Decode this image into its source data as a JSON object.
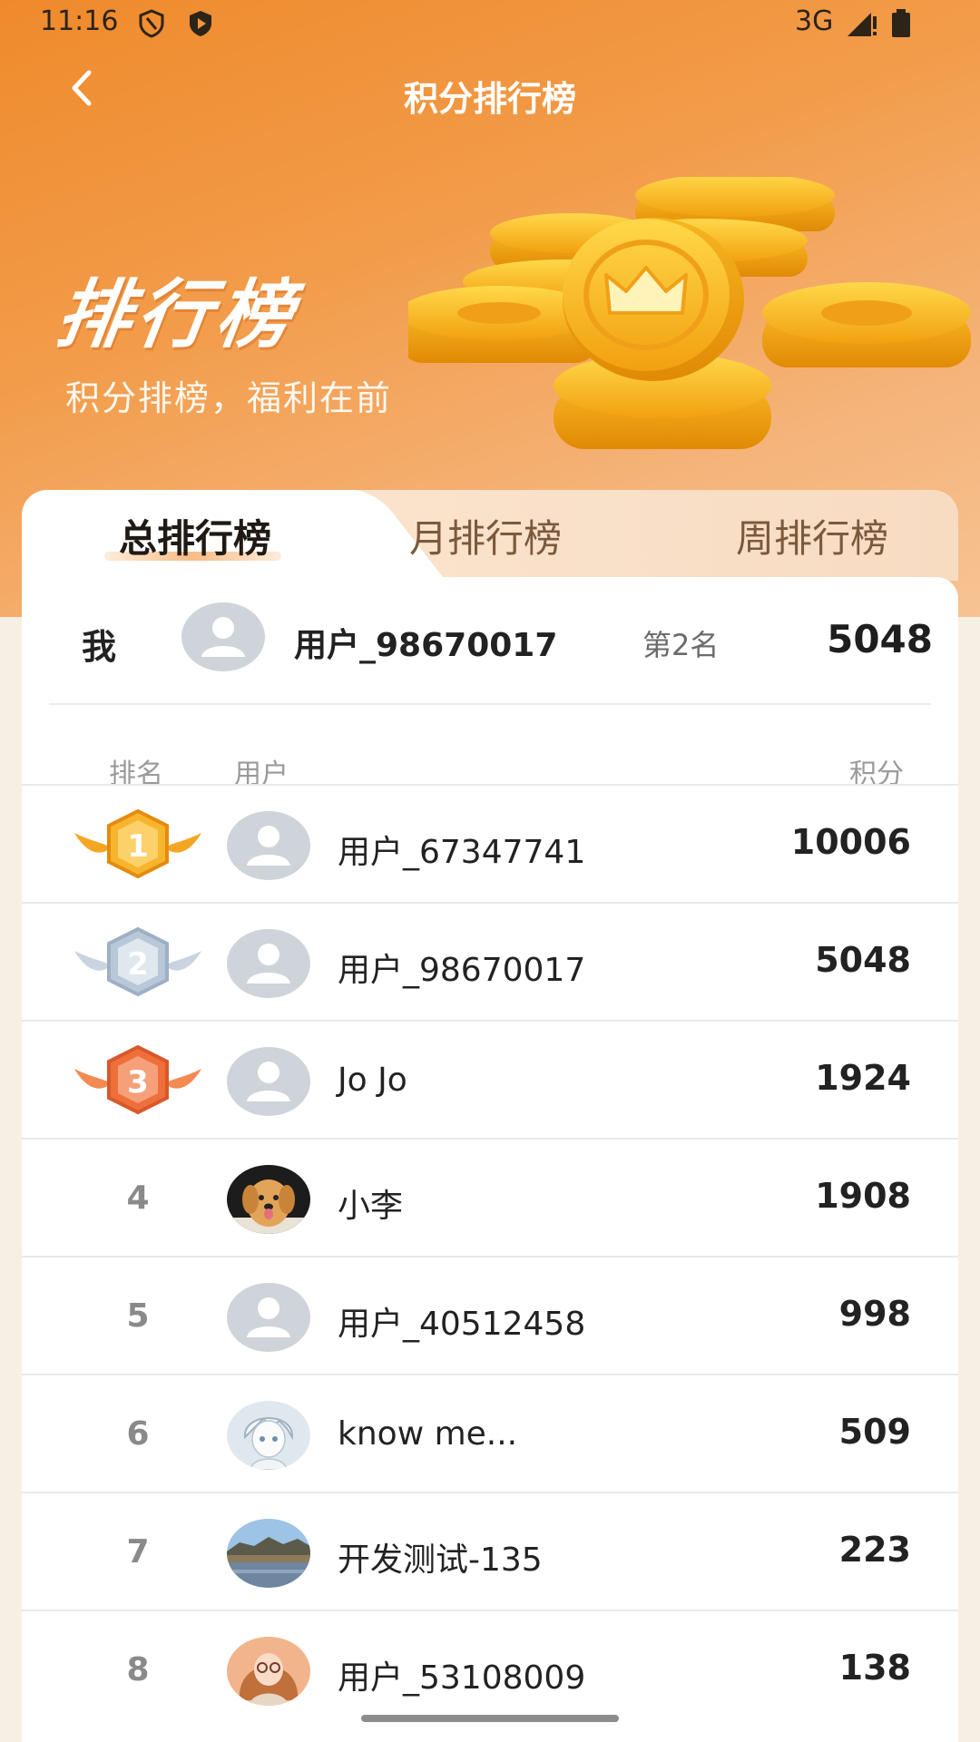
{
  "status_bar": {
    "time": "11:16",
    "network": "3G"
  },
  "nav": {
    "title": "积分排行榜"
  },
  "hero": {
    "title": "排行榜",
    "subtitle": "积分排榜，福利在前"
  },
  "tabs": [
    {
      "label": "总排行榜",
      "active": true
    },
    {
      "label": "月排行榜",
      "active": false
    },
    {
      "label": "周排行榜",
      "active": false
    }
  ],
  "me": {
    "label": "我",
    "name": "用户_98670017",
    "rank": "第2名",
    "score": "5048"
  },
  "list_header": {
    "rank": "排名",
    "user": "用户",
    "score": "积分"
  },
  "rows": [
    {
      "rank": "1",
      "badge": "gold",
      "name": "用户_67347741",
      "score": "10006",
      "avatar": "default"
    },
    {
      "rank": "2",
      "badge": "silver",
      "name": "用户_98670017",
      "score": "5048",
      "avatar": "default"
    },
    {
      "rank": "3",
      "badge": "bronze",
      "name": "Jo Jo",
      "score": "1924",
      "avatar": "default"
    },
    {
      "rank": "4",
      "badge": "",
      "name": "小李",
      "score": "1908",
      "avatar": "dog-photo"
    },
    {
      "rank": "5",
      "badge": "",
      "name": "用户_40512458",
      "score": "998",
      "avatar": "default"
    },
    {
      "rank": "6",
      "badge": "",
      "name": "know me...",
      "score": "509",
      "avatar": "anime-sketch"
    },
    {
      "rank": "7",
      "badge": "",
      "name": "开发测试-135",
      "score": "223",
      "avatar": "landscape-photo"
    },
    {
      "rank": "8",
      "badge": "",
      "name": "用户_53108009",
      "score": "138",
      "avatar": "girl-photo"
    }
  ],
  "colors": {
    "brand_orange": "#ef8a2c",
    "gold": "#f4a622",
    "silver": "#b9c8d8",
    "bronze": "#ee6f3a"
  }
}
